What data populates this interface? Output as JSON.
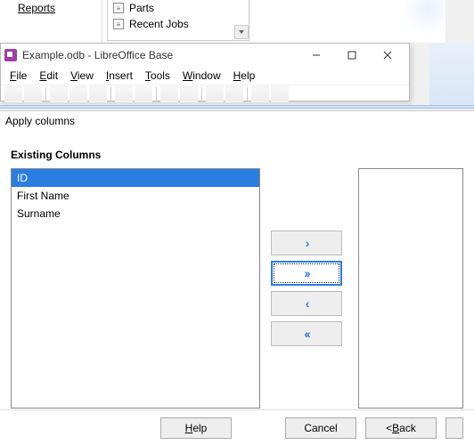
{
  "bg": {
    "sidebar_item": "Reports",
    "list": [
      "Parts",
      "Recent Jobs"
    ]
  },
  "app": {
    "title": "Example.odb - LibreOffice Base",
    "menu": {
      "file": "File",
      "edit": "Edit",
      "view": "View",
      "insert": "Insert",
      "tools": "Tools",
      "window": "Window",
      "help": "Help"
    }
  },
  "dialog": {
    "title": "Apply columns",
    "section": "Existing Columns",
    "existing": [
      "ID",
      "First Name",
      "Surname"
    ],
    "buttons": {
      "help": "Help",
      "cancel": "Cancel",
      "back": "< Back"
    }
  }
}
